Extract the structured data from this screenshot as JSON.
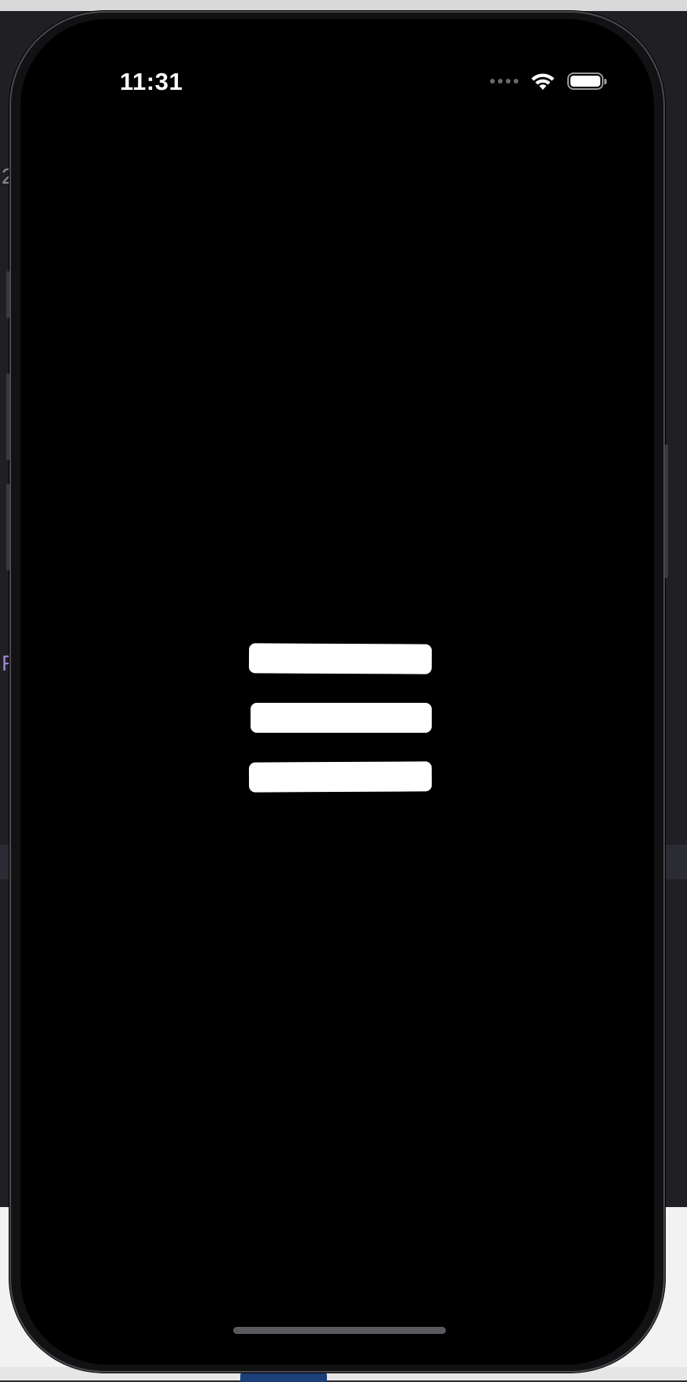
{
  "status_bar": {
    "time": "11:31",
    "icons": [
      "cellular-signal-icon",
      "wifi-icon",
      "battery-icon"
    ],
    "battery_fraction": 1.0
  },
  "screen": {
    "background": "#000000",
    "center_icon": "menu-icon",
    "icon_color": "#ffffff"
  },
  "background_peek": {
    "left_edge_characters": [
      "2",
      "F"
    ]
  }
}
